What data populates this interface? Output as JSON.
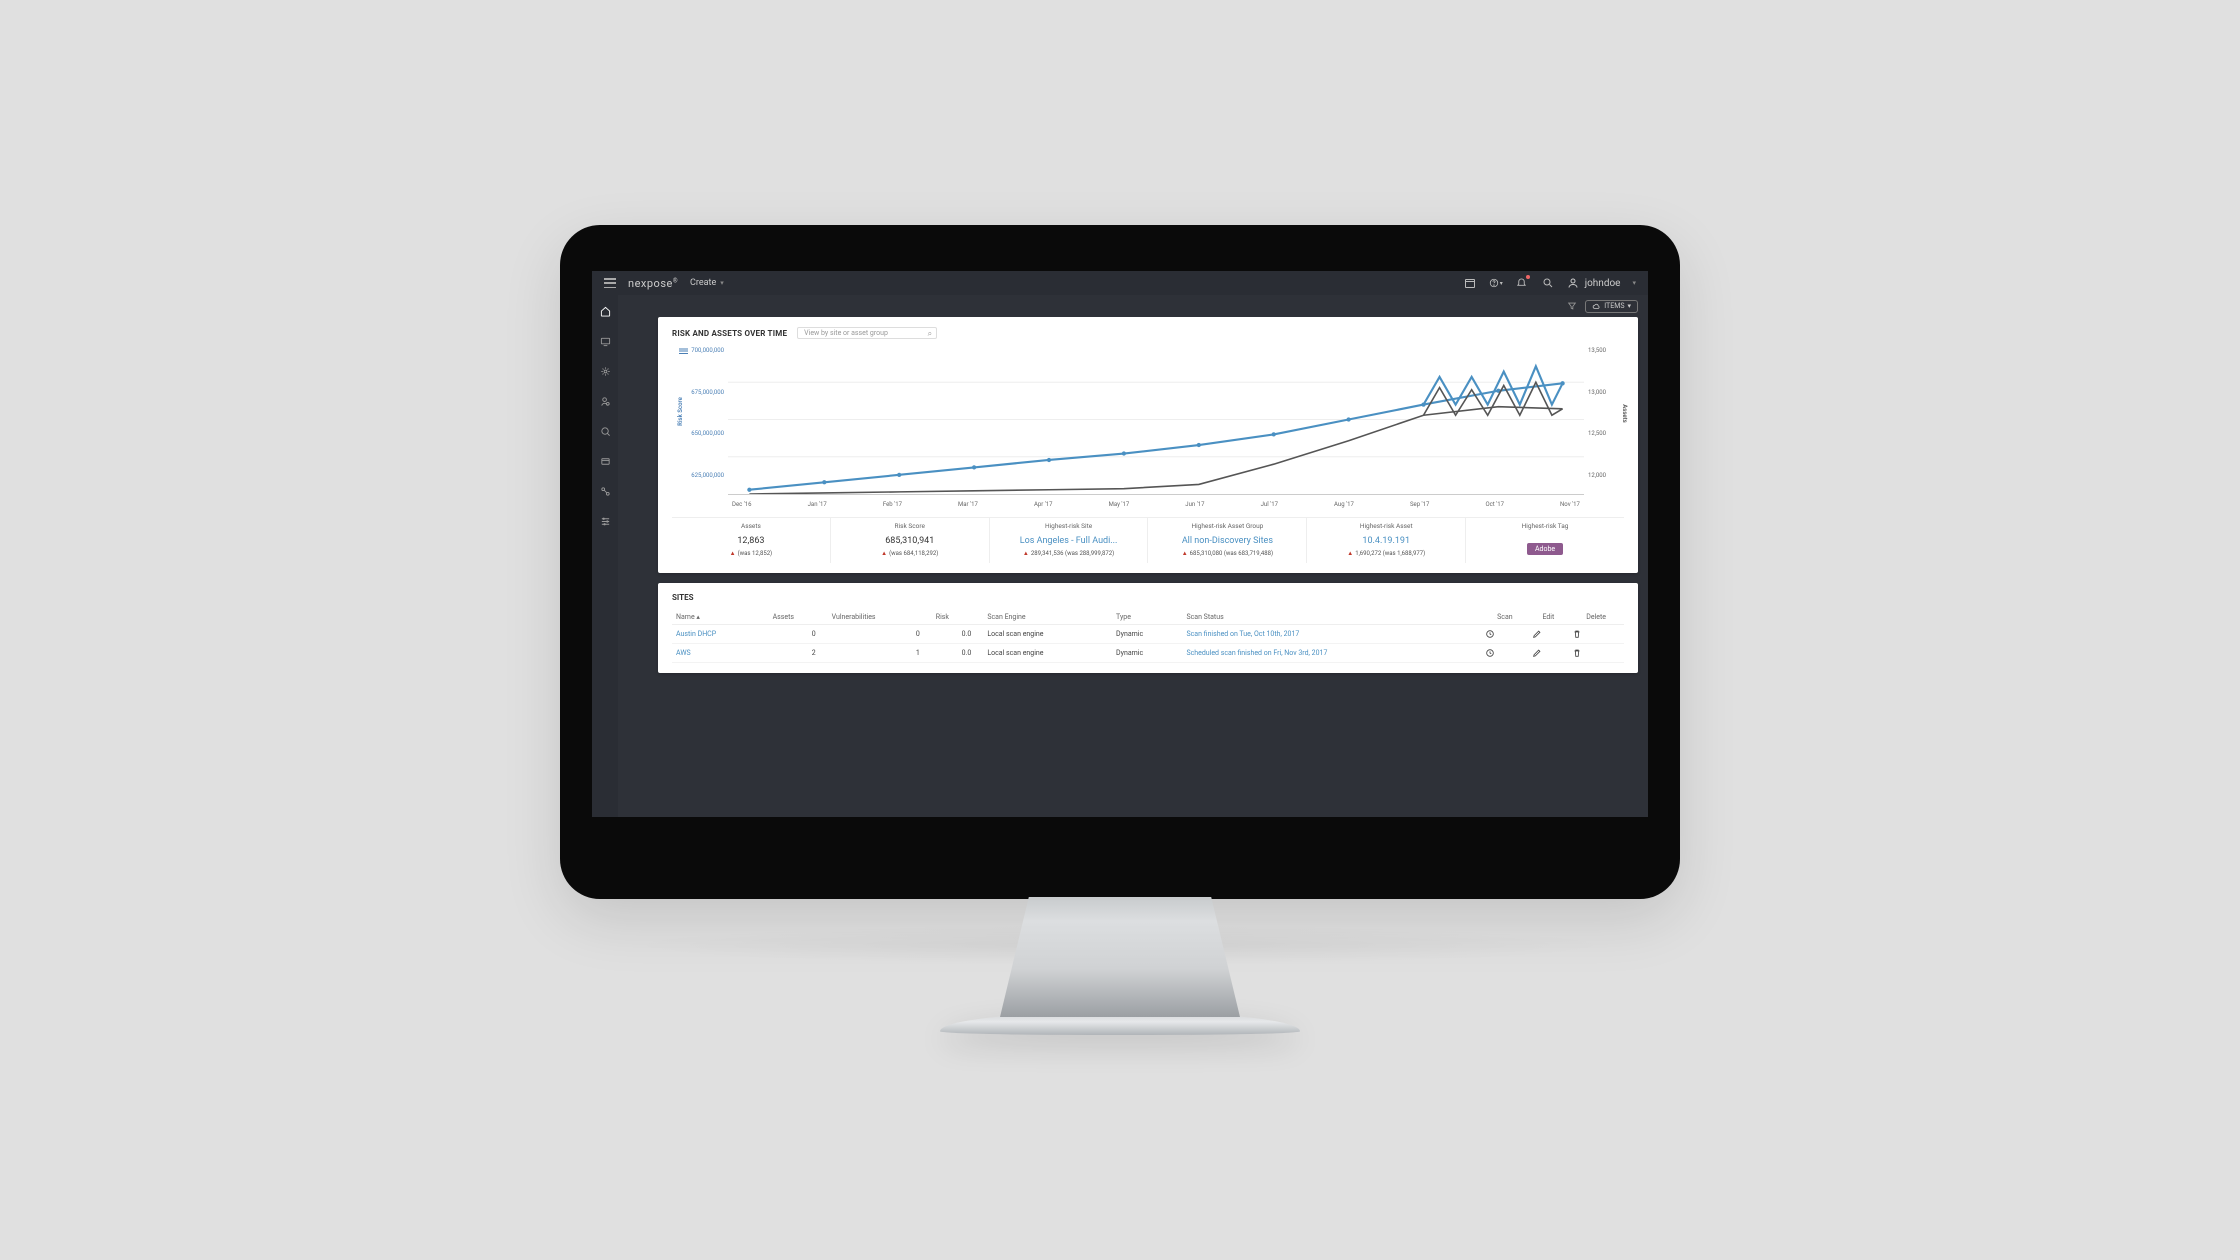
{
  "header": {
    "brand": "nexpose",
    "create_label": "Create",
    "username": "johndoe"
  },
  "toolbar": {
    "items_label": "ITEMS"
  },
  "chart_card": {
    "title": "RISK AND ASSETS OVER TIME",
    "search_placeholder": "View by site or asset group"
  },
  "chart_data": {
    "type": "line",
    "title": "RISK AND ASSETS OVER TIME",
    "xlabel": "",
    "ylabel_left": "Risk Score",
    "ylabel_right": "Assets",
    "x_categories": [
      "Dec '16",
      "Jan '17",
      "Feb '17",
      "Mar '17",
      "Apr '17",
      "May '17",
      "Jun '17",
      "Jul '17",
      "Aug '17",
      "Sep '17",
      "Oct '17",
      "Nov '17"
    ],
    "y_left_ticks": [
      "700,000,000",
      "675,000,000",
      "650,000,000",
      "625,000,000"
    ],
    "y_right_ticks": [
      "13,500",
      "13,000",
      "12,500",
      "12,000"
    ],
    "series": [
      {
        "name": "Risk Score",
        "axis": "left",
        "color": "#4a90c2",
        "values": [
          627000000,
          631000000,
          636000000,
          641000000,
          646000000,
          651000000,
          657000000,
          663000000,
          672000000,
          680000000,
          688000000,
          693000000
        ]
      },
      {
        "name": "Assets",
        "axis": "right",
        "color": "#555",
        "values": [
          12000,
          12010,
          12020,
          12030,
          12040,
          12050,
          12100,
          12300,
          12550,
          12800,
          12900,
          12863
        ]
      }
    ]
  },
  "stats": [
    {
      "label": "Assets",
      "value": "12,863",
      "delta": "(was 12,852)",
      "link": false
    },
    {
      "label": "Risk Score",
      "value": "685,310,941",
      "delta": "(was 684,118,292)",
      "link": false
    },
    {
      "label": "Highest-risk Site",
      "value": "Los Angeles - Full Audi...",
      "delta": "289,341,536 (was 288,999,872)",
      "link": true
    },
    {
      "label": "Highest-risk Asset Group",
      "value": "All non-Discovery Sites",
      "delta": "685,310,080 (was 683,719,488)",
      "link": true
    },
    {
      "label": "Highest-risk Asset",
      "value": "10.4.19.191",
      "delta": "1,690,272 (was 1,688,977)",
      "link": true
    },
    {
      "label": "Highest-risk Tag",
      "value_tag": "Adobe",
      "link": false
    }
  ],
  "sites": {
    "title": "SITES",
    "columns": [
      "Name",
      "Assets",
      "Vulnerabilities",
      "Risk",
      "Scan Engine",
      "Type",
      "Scan Status",
      "Scan",
      "Edit",
      "Delete"
    ],
    "rows": [
      {
        "name": "Austin DHCP",
        "assets": "0",
        "vulns": "0",
        "risk": "0.0",
        "engine": "Local scan engine",
        "type": "Dynamic",
        "status": "Scan finished on Tue, Oct 10th, 2017"
      },
      {
        "name": "AWS",
        "assets": "2",
        "vulns": "1",
        "risk": "0.0",
        "engine": "Local scan engine",
        "type": "Dynamic",
        "status": "Scheduled scan finished on Fri, Nov 3rd, 2017"
      }
    ]
  }
}
